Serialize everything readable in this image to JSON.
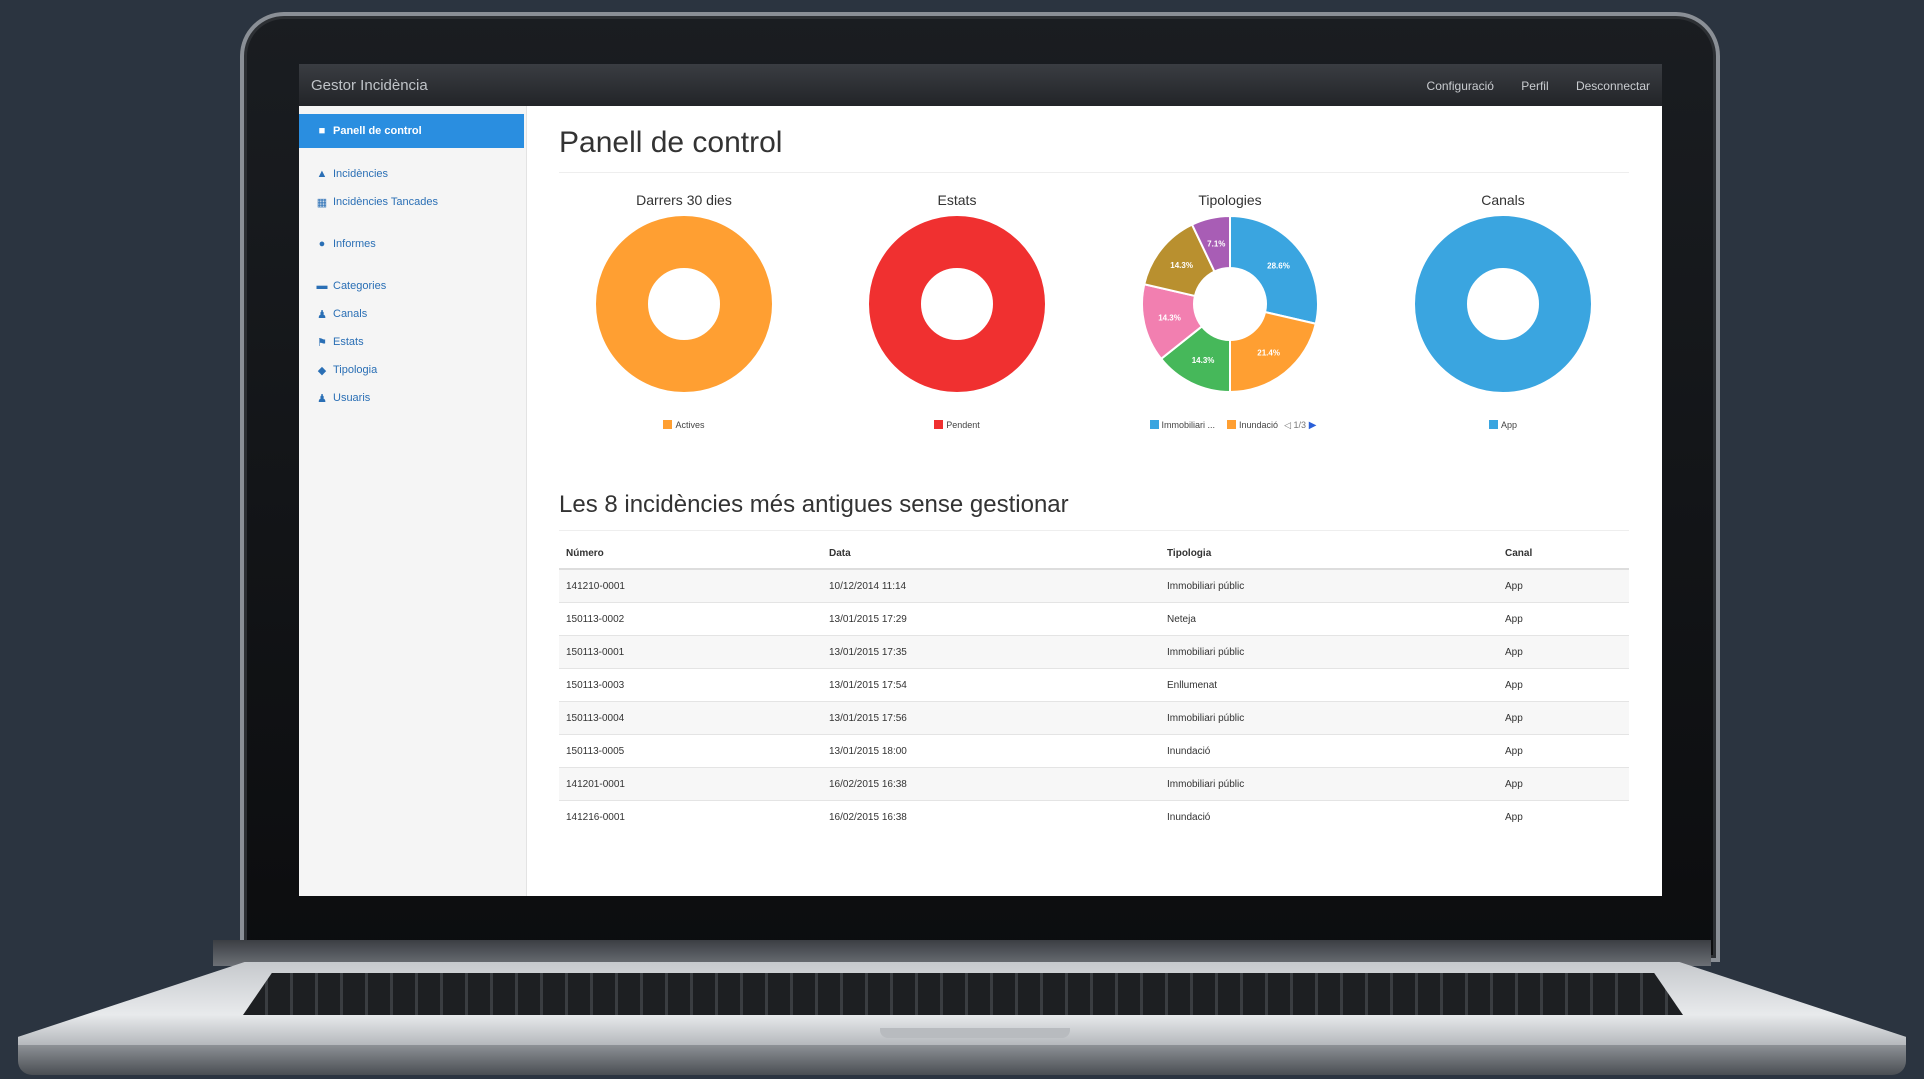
{
  "app": {
    "brand": "Gestor Incidència",
    "topnav": [
      "Configuració",
      "Perfil",
      "Desconnectar"
    ]
  },
  "sidebar": {
    "items": [
      {
        "label": "Panell de control",
        "icon": "dashboard-icon",
        "active": true
      },
      {
        "label": "Incidències",
        "icon": "warning-icon"
      },
      {
        "label": "Incidències Tancades",
        "icon": "list-icon"
      },
      {
        "label": "Informes",
        "icon": "globe-icon"
      },
      {
        "label": "Categories",
        "icon": "folder-icon"
      },
      {
        "label": "Canals",
        "icon": "user-icon"
      },
      {
        "label": "Estats",
        "icon": "flag-icon"
      },
      {
        "label": "Tipologia",
        "icon": "tag-icon"
      },
      {
        "label": "Usuaris",
        "icon": "user-icon"
      }
    ]
  },
  "main": {
    "title": "Panell de control",
    "section_title": "Les 8 incidències més antigues sense gestionar"
  },
  "chart_data": [
    {
      "type": "pie",
      "title": "Darrers 30 dies",
      "series": [
        {
          "name": "Actives",
          "value": 100,
          "color": "#ff9f32"
        }
      ],
      "legend": [
        {
          "label": "Actives",
          "color": "#ff9f32"
        }
      ]
    },
    {
      "type": "pie",
      "title": "Estats",
      "series": [
        {
          "name": "Pendent",
          "value": 100,
          "color": "#f03030"
        }
      ],
      "legend": [
        {
          "label": "Pendent",
          "color": "#f03030"
        }
      ]
    },
    {
      "type": "pie",
      "title": "Tipologies",
      "series": [
        {
          "name": "Immobiliari públic",
          "value": 28.6,
          "label": "28.6%",
          "color": "#3aa5e0"
        },
        {
          "name": "Inundació",
          "value": 21.4,
          "label": "21.4%",
          "color": "#ff9f32"
        },
        {
          "name": "",
          "value": 14.3,
          "label": "14.3%",
          "color": "#46b85a"
        },
        {
          "name": "",
          "value": 14.3,
          "label": "14.3%",
          "color": "#f27fb0"
        },
        {
          "name": "",
          "value": 14.3,
          "label": "14.3%",
          "color": "#b9902f"
        },
        {
          "name": "",
          "value": 7.1,
          "label": "7.1%",
          "color": "#a85db5"
        }
      ],
      "legend": [
        {
          "label": "Immobiliari ...",
          "color": "#3aa5e0"
        },
        {
          "label": "Inundació",
          "color": "#ff9f32"
        }
      ],
      "pager": "1/3"
    },
    {
      "type": "pie",
      "title": "Canals",
      "series": [
        {
          "name": "App",
          "value": 100,
          "color": "#3aa5e0"
        }
      ],
      "legend": [
        {
          "label": "App",
          "color": "#3aa5e0"
        }
      ]
    }
  ],
  "table": {
    "headers": [
      "Número",
      "Data",
      "Tipologia",
      "Canal"
    ],
    "rows": [
      [
        "141210-0001",
        "10/12/2014 11:14",
        "Immobiliari públic",
        "App"
      ],
      [
        "150113-0002",
        "13/01/2015 17:29",
        "Neteja",
        "App"
      ],
      [
        "150113-0001",
        "13/01/2015 17:35",
        "Immobiliari públic",
        "App"
      ],
      [
        "150113-0003",
        "13/01/2015 17:54",
        "Enllumenat",
        "App"
      ],
      [
        "150113-0004",
        "13/01/2015 17:56",
        "Immobiliari públic",
        "App"
      ],
      [
        "150113-0005",
        "13/01/2015 18:00",
        "Inundació",
        "App"
      ],
      [
        "141201-0001",
        "16/02/2015 16:38",
        "Immobiliari públic",
        "App"
      ],
      [
        "141216-0001",
        "16/02/2015 16:38",
        "Inundació",
        "App"
      ]
    ]
  }
}
